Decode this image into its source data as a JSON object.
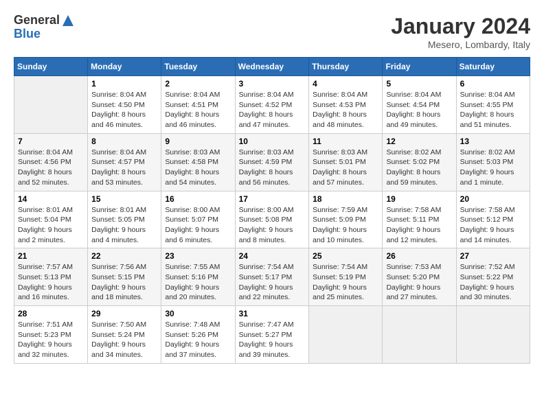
{
  "logo": {
    "general": "General",
    "blue": "Blue"
  },
  "title": "January 2024",
  "subtitle": "Mesero, Lombardy, Italy",
  "days_header": [
    "Sunday",
    "Monday",
    "Tuesday",
    "Wednesday",
    "Thursday",
    "Friday",
    "Saturday"
  ],
  "weeks": [
    [
      {
        "day": "",
        "info": ""
      },
      {
        "day": "1",
        "info": "Sunrise: 8:04 AM\nSunset: 4:50 PM\nDaylight: 8 hours\nand 46 minutes."
      },
      {
        "day": "2",
        "info": "Sunrise: 8:04 AM\nSunset: 4:51 PM\nDaylight: 8 hours\nand 46 minutes."
      },
      {
        "day": "3",
        "info": "Sunrise: 8:04 AM\nSunset: 4:52 PM\nDaylight: 8 hours\nand 47 minutes."
      },
      {
        "day": "4",
        "info": "Sunrise: 8:04 AM\nSunset: 4:53 PM\nDaylight: 8 hours\nand 48 minutes."
      },
      {
        "day": "5",
        "info": "Sunrise: 8:04 AM\nSunset: 4:54 PM\nDaylight: 8 hours\nand 49 minutes."
      },
      {
        "day": "6",
        "info": "Sunrise: 8:04 AM\nSunset: 4:55 PM\nDaylight: 8 hours\nand 51 minutes."
      }
    ],
    [
      {
        "day": "7",
        "info": "Sunrise: 8:04 AM\nSunset: 4:56 PM\nDaylight: 8 hours\nand 52 minutes."
      },
      {
        "day": "8",
        "info": "Sunrise: 8:04 AM\nSunset: 4:57 PM\nDaylight: 8 hours\nand 53 minutes."
      },
      {
        "day": "9",
        "info": "Sunrise: 8:03 AM\nSunset: 4:58 PM\nDaylight: 8 hours\nand 54 minutes."
      },
      {
        "day": "10",
        "info": "Sunrise: 8:03 AM\nSunset: 4:59 PM\nDaylight: 8 hours\nand 56 minutes."
      },
      {
        "day": "11",
        "info": "Sunrise: 8:03 AM\nSunset: 5:01 PM\nDaylight: 8 hours\nand 57 minutes."
      },
      {
        "day": "12",
        "info": "Sunrise: 8:02 AM\nSunset: 5:02 PM\nDaylight: 8 hours\nand 59 minutes."
      },
      {
        "day": "13",
        "info": "Sunrise: 8:02 AM\nSunset: 5:03 PM\nDaylight: 9 hours\nand 1 minute."
      }
    ],
    [
      {
        "day": "14",
        "info": "Sunrise: 8:01 AM\nSunset: 5:04 PM\nDaylight: 9 hours\nand 2 minutes."
      },
      {
        "day": "15",
        "info": "Sunrise: 8:01 AM\nSunset: 5:05 PM\nDaylight: 9 hours\nand 4 minutes."
      },
      {
        "day": "16",
        "info": "Sunrise: 8:00 AM\nSunset: 5:07 PM\nDaylight: 9 hours\nand 6 minutes."
      },
      {
        "day": "17",
        "info": "Sunrise: 8:00 AM\nSunset: 5:08 PM\nDaylight: 9 hours\nand 8 minutes."
      },
      {
        "day": "18",
        "info": "Sunrise: 7:59 AM\nSunset: 5:09 PM\nDaylight: 9 hours\nand 10 minutes."
      },
      {
        "day": "19",
        "info": "Sunrise: 7:58 AM\nSunset: 5:11 PM\nDaylight: 9 hours\nand 12 minutes."
      },
      {
        "day": "20",
        "info": "Sunrise: 7:58 AM\nSunset: 5:12 PM\nDaylight: 9 hours\nand 14 minutes."
      }
    ],
    [
      {
        "day": "21",
        "info": "Sunrise: 7:57 AM\nSunset: 5:13 PM\nDaylight: 9 hours\nand 16 minutes."
      },
      {
        "day": "22",
        "info": "Sunrise: 7:56 AM\nSunset: 5:15 PM\nDaylight: 9 hours\nand 18 minutes."
      },
      {
        "day": "23",
        "info": "Sunrise: 7:55 AM\nSunset: 5:16 PM\nDaylight: 9 hours\nand 20 minutes."
      },
      {
        "day": "24",
        "info": "Sunrise: 7:54 AM\nSunset: 5:17 PM\nDaylight: 9 hours\nand 22 minutes."
      },
      {
        "day": "25",
        "info": "Sunrise: 7:54 AM\nSunset: 5:19 PM\nDaylight: 9 hours\nand 25 minutes."
      },
      {
        "day": "26",
        "info": "Sunrise: 7:53 AM\nSunset: 5:20 PM\nDaylight: 9 hours\nand 27 minutes."
      },
      {
        "day": "27",
        "info": "Sunrise: 7:52 AM\nSunset: 5:22 PM\nDaylight: 9 hours\nand 30 minutes."
      }
    ],
    [
      {
        "day": "28",
        "info": "Sunrise: 7:51 AM\nSunset: 5:23 PM\nDaylight: 9 hours\nand 32 minutes."
      },
      {
        "day": "29",
        "info": "Sunrise: 7:50 AM\nSunset: 5:24 PM\nDaylight: 9 hours\nand 34 minutes."
      },
      {
        "day": "30",
        "info": "Sunrise: 7:48 AM\nSunset: 5:26 PM\nDaylight: 9 hours\nand 37 minutes."
      },
      {
        "day": "31",
        "info": "Sunrise: 7:47 AM\nSunset: 5:27 PM\nDaylight: 9 hours\nand 39 minutes."
      },
      {
        "day": "",
        "info": ""
      },
      {
        "day": "",
        "info": ""
      },
      {
        "day": "",
        "info": ""
      }
    ]
  ]
}
